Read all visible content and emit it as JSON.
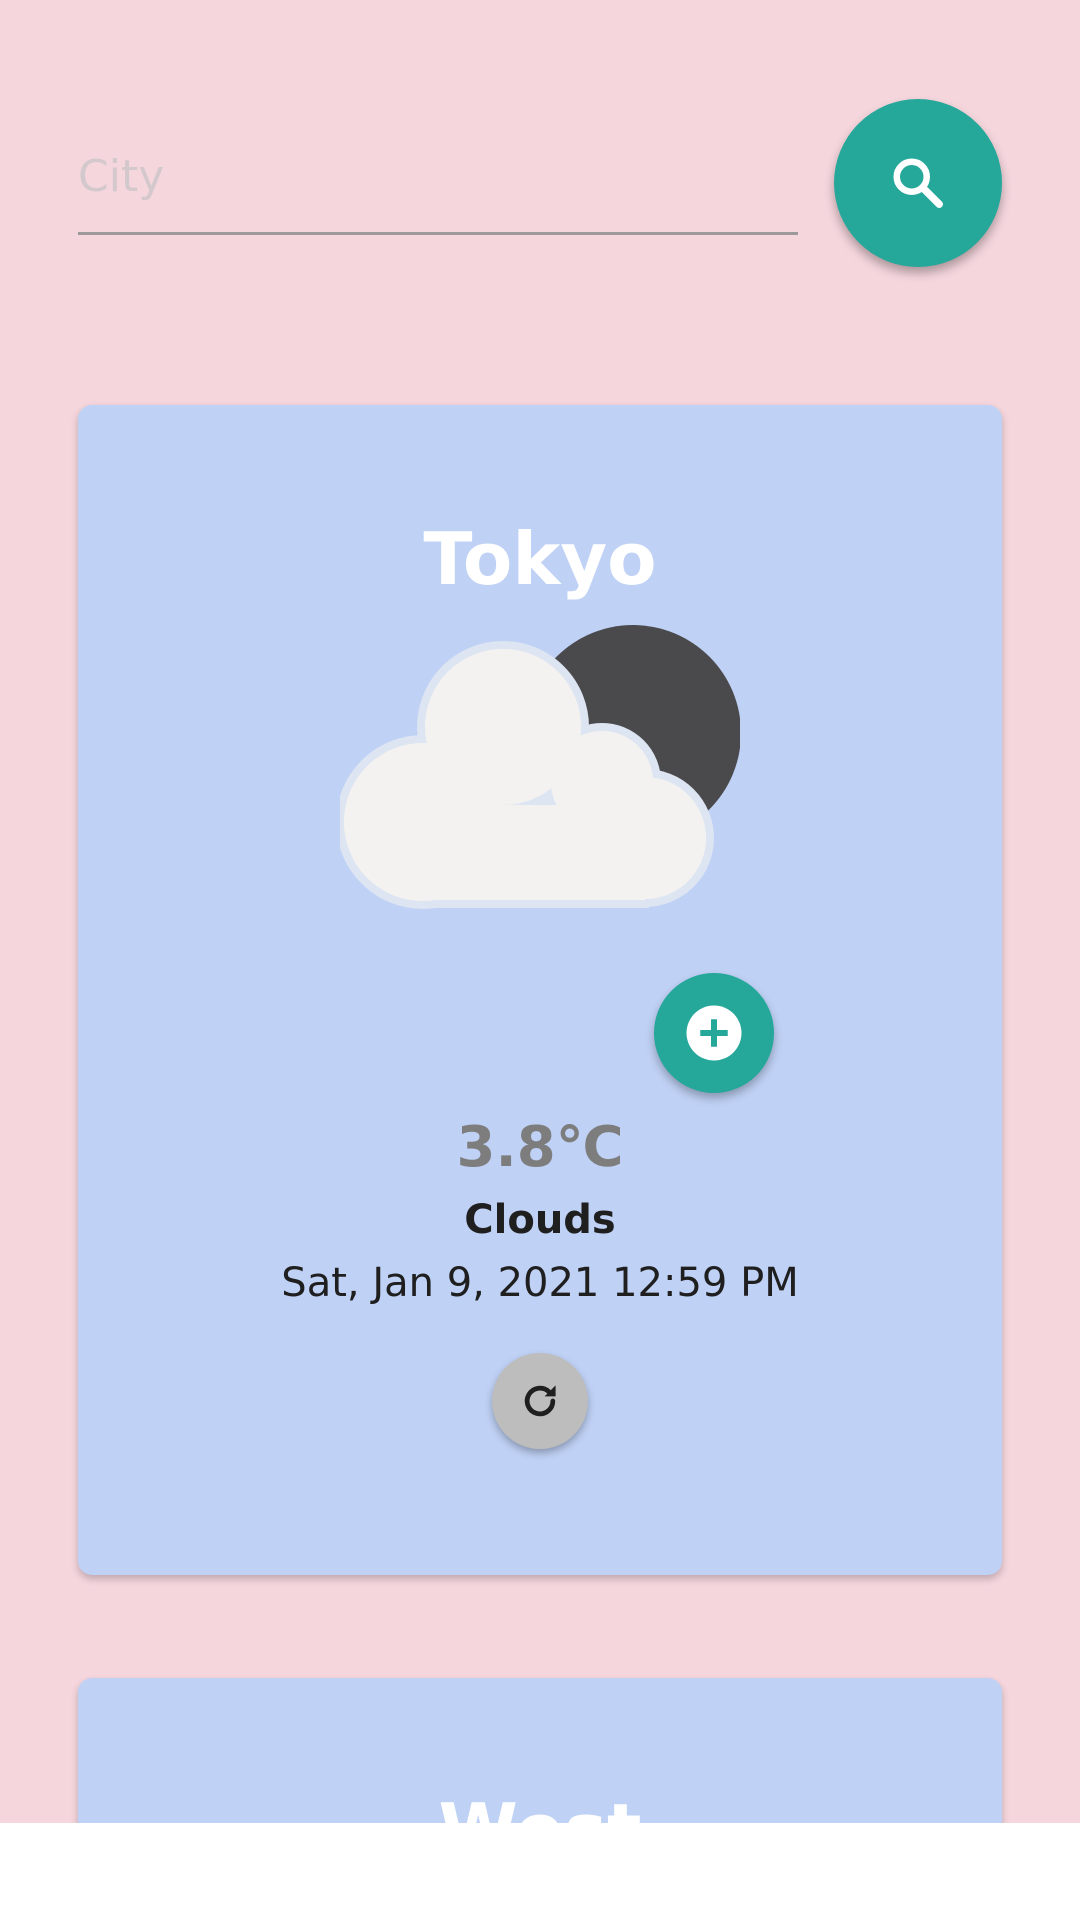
{
  "search": {
    "placeholder": "City",
    "value": "",
    "button_icon": "search-icon"
  },
  "colors": {
    "background": "#f5d6dd",
    "card": "#bfd1f5",
    "accent": "#25a79a",
    "refresh": "#bdbdbd",
    "temperature": "#7d7d7d"
  },
  "cards": [
    {
      "city": "Tokyo",
      "icon": "cloud-moon-icon",
      "temperature": "3.8℃",
      "condition": "Clouds",
      "datetime": "Sat, Jan 9, 2021 12:59 PM",
      "favorite_icon": "plus-circle-icon",
      "refresh_icon": "refresh-icon"
    },
    {
      "city": "West"
    }
  ]
}
